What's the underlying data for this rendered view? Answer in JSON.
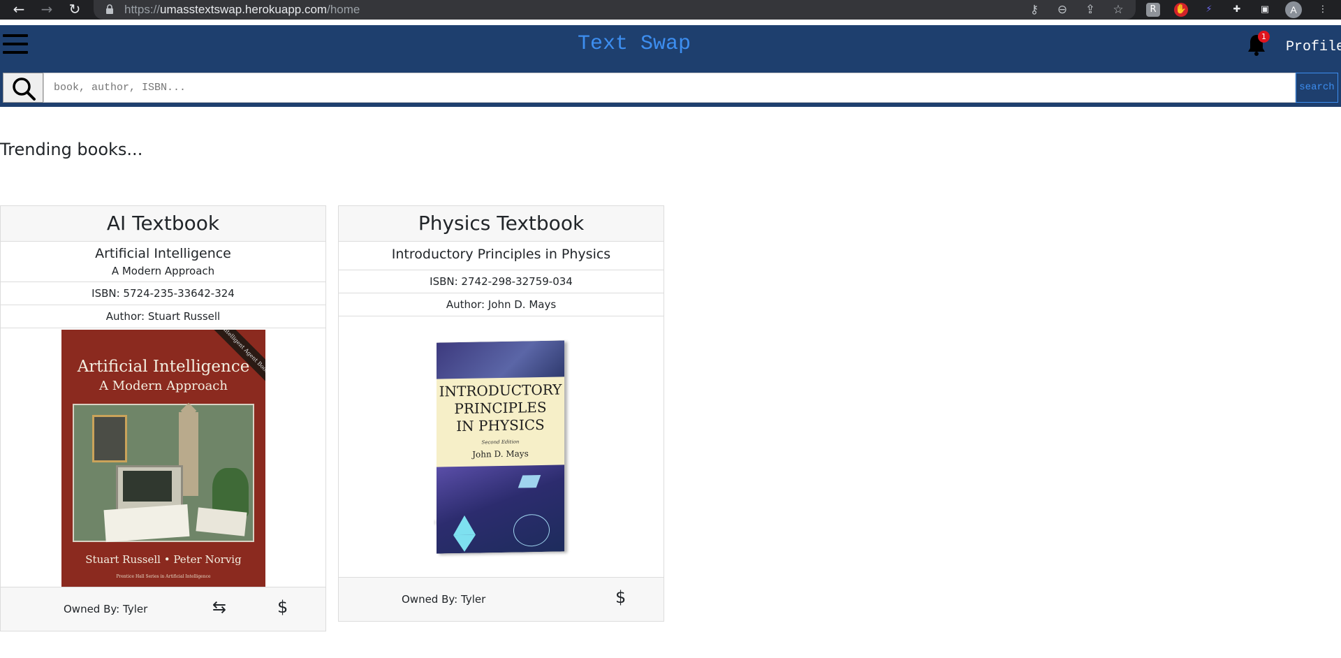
{
  "browser": {
    "url_scheme": "https://",
    "url_host": "umasstextswap.herokuapp.com",
    "url_path": "/home",
    "avatar_letter": "A"
  },
  "header": {
    "brand": "Text Swap",
    "notification_count": "1",
    "profile_label": "Profile",
    "colors": {
      "bar": "#1e3f6e",
      "brand": "#3d8ef0"
    }
  },
  "search": {
    "placeholder": "book, author, ISBN...",
    "submit_label": "search"
  },
  "main": {
    "heading": "Trending books...",
    "books": [
      {
        "category": "AI Textbook",
        "title": "Artificial Intelligence",
        "subtitle": "A Modern Approach",
        "isbn": "ISBN: 5724-235-33642-324",
        "author": "Author: Stuart Russell",
        "owner": "Owned By: Tyler",
        "cover": {
          "title_line1": "Artificial Intelligence",
          "title_line2": "A Modern Approach",
          "authors": "Stuart Russell • Peter Norvig",
          "series": "Prentice Hall Series in Artificial Intelligence",
          "ribbon": "The Intelligent Agent Book",
          "color": "#8b2a1f"
        },
        "actions": [
          "swap-icon",
          "price-icon"
        ]
      },
      {
        "category": "Physics Textbook",
        "title": "Introductory Principles in Physics",
        "isbn": "ISBN: 2742-298-32759-034",
        "author": "Author: John D. Mays",
        "owner": "Owned By: Tyler",
        "cover": {
          "line1": "INTRODUCTORY",
          "line2": "PRINCIPLES",
          "line3": "IN PHYSICS",
          "edition": "Second Edition",
          "author": "John D. Mays",
          "color": "#f6efc8"
        },
        "actions": [
          "price-icon"
        ]
      }
    ]
  },
  "icons": {
    "swap": "⇆",
    "price": "$"
  }
}
